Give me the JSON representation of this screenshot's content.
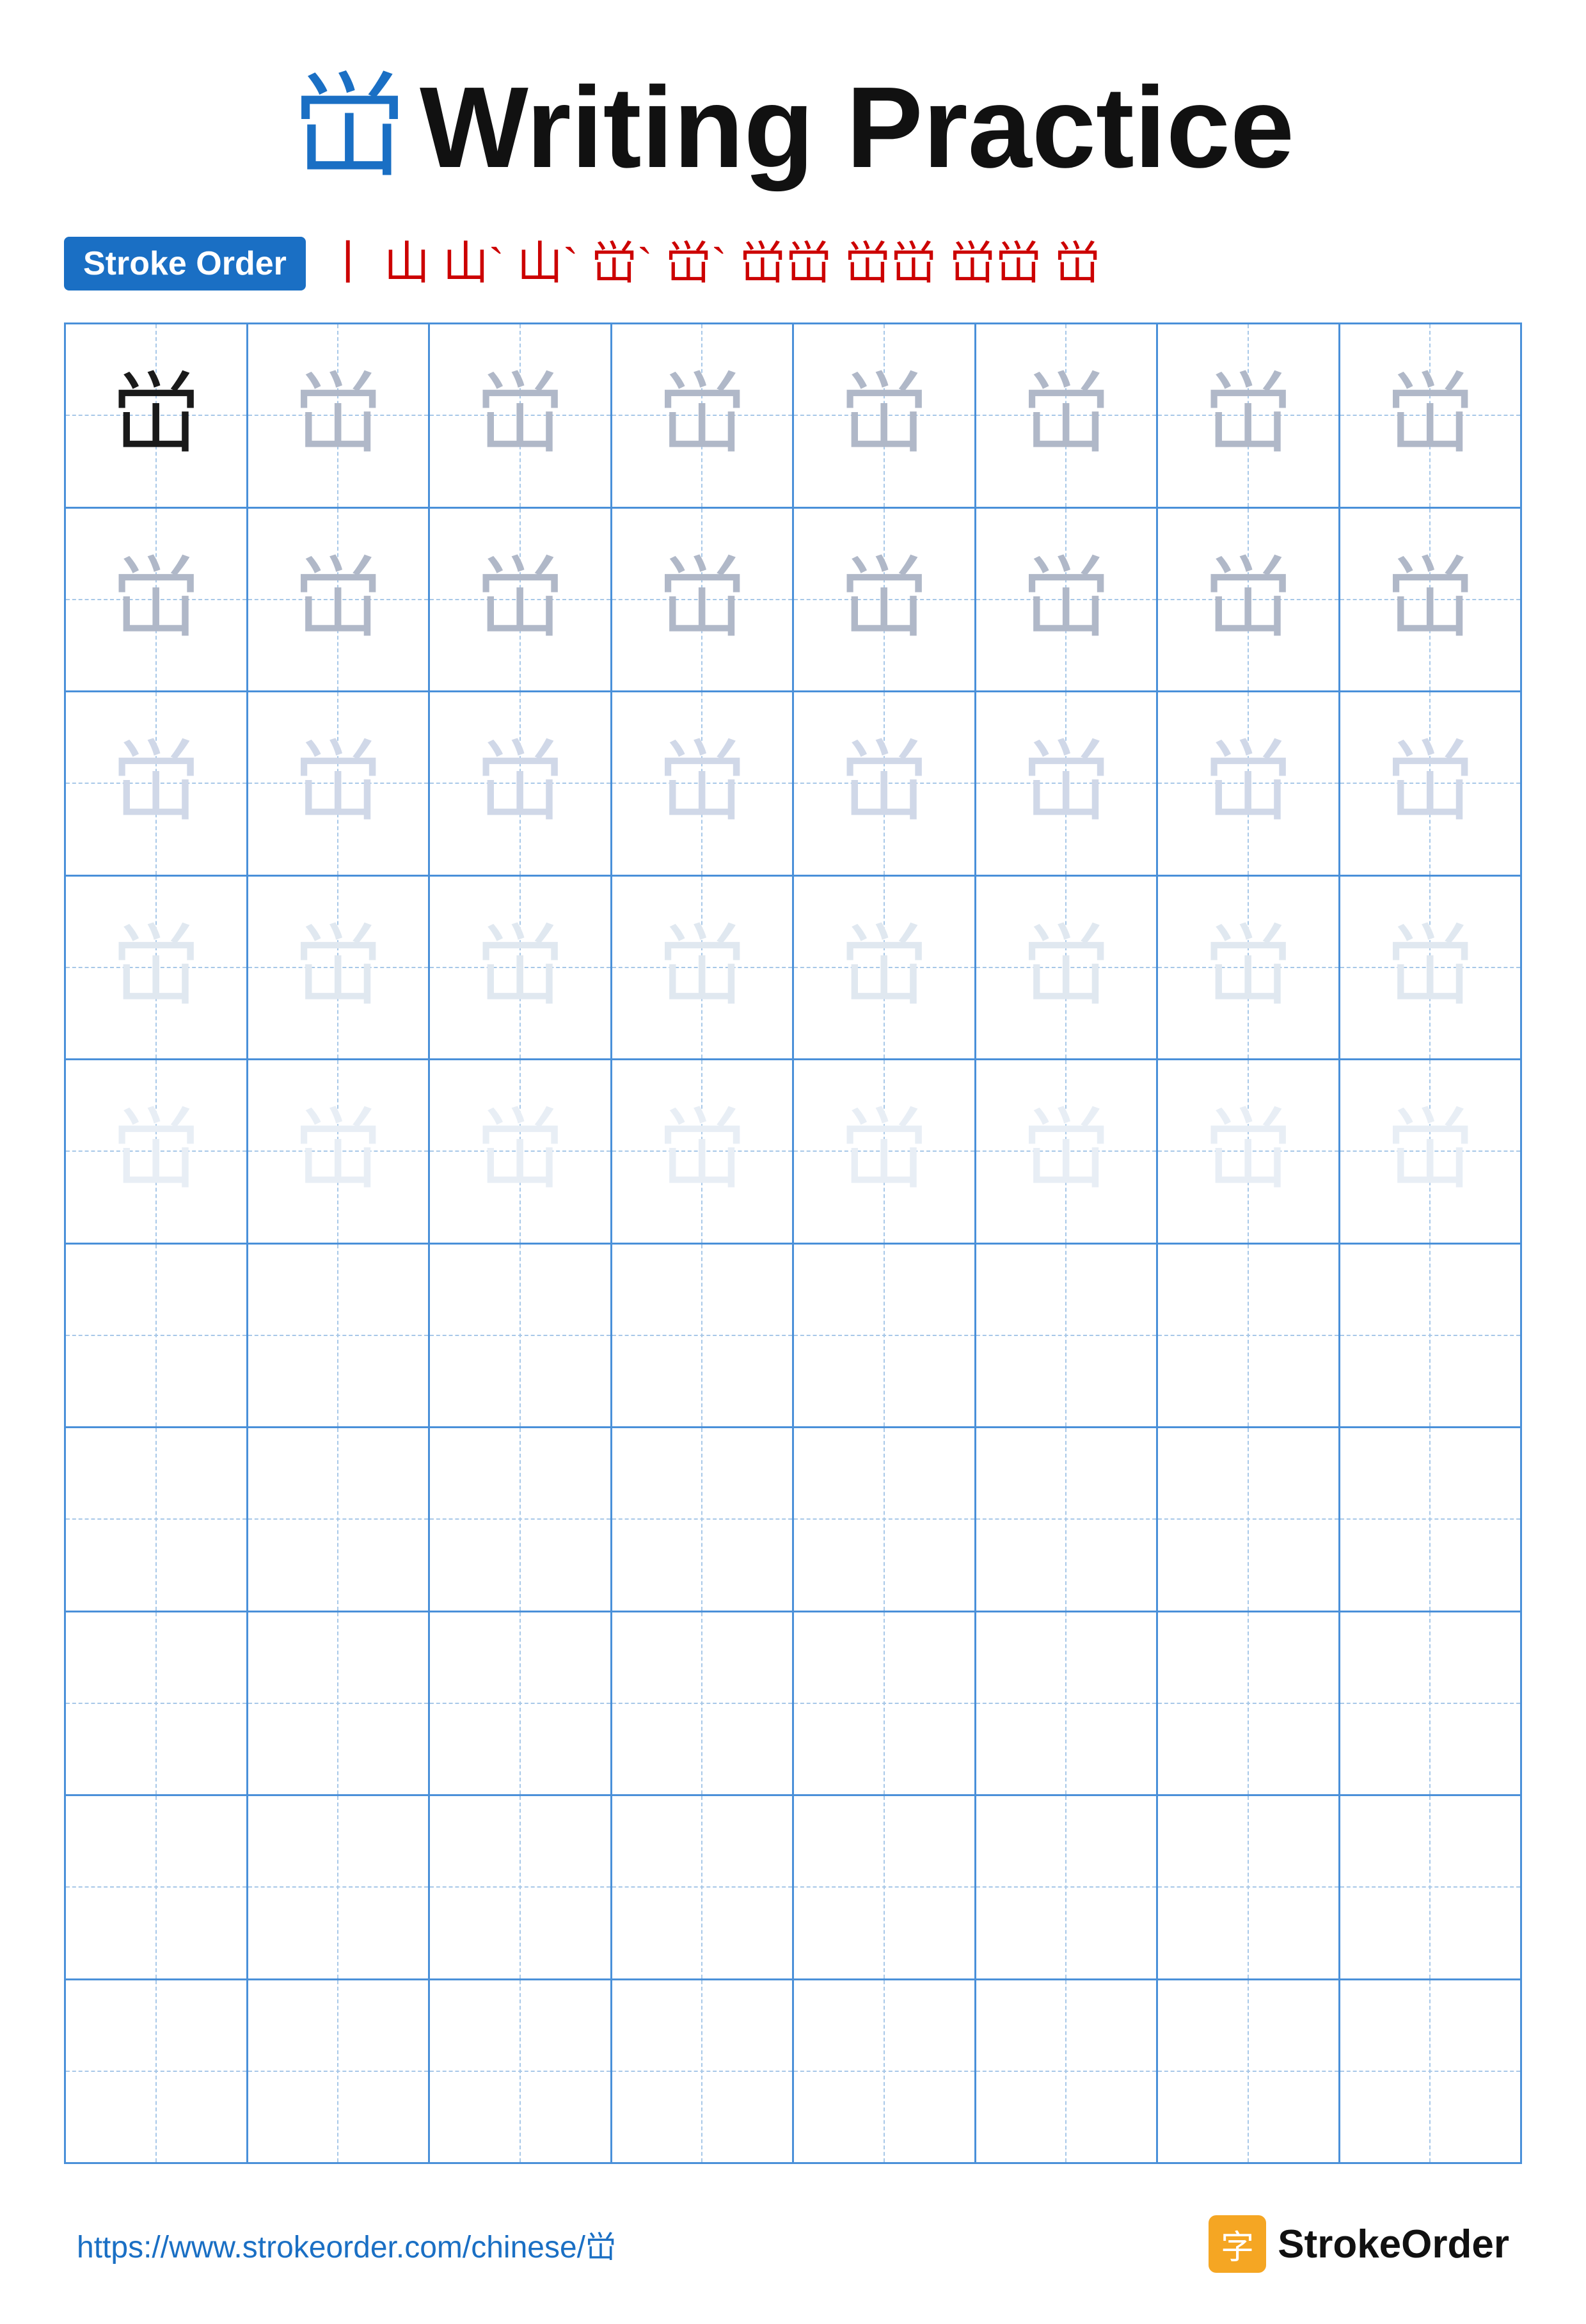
{
  "title": {
    "char": "峃",
    "text": "Writing Practice"
  },
  "stroke_order": {
    "badge_label": "Stroke Order",
    "strokes": [
      "丨",
      "山",
      "山`",
      "山`",
      "峃`",
      "峃`",
      "峃峃",
      "峃峃",
      "峃峃",
      "峃"
    ]
  },
  "grid": {
    "rows": 10,
    "cols": 8,
    "char": "峃",
    "filled_rows": 5,
    "opacity_levels": [
      "dark",
      "medium",
      "light",
      "very-light",
      "faint"
    ]
  },
  "footer": {
    "url": "https://www.strokeorder.com/chinese/峃",
    "brand_name": "StrokeOrder"
  }
}
